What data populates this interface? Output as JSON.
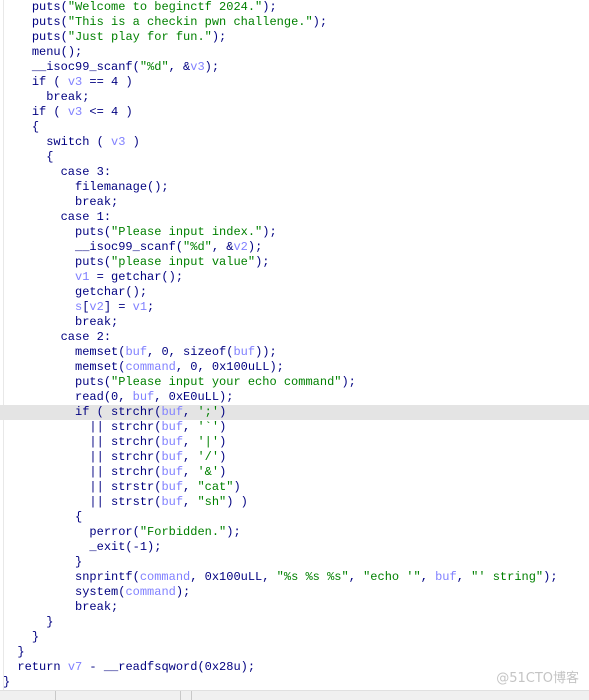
{
  "view": "pseudocode",
  "highlighted_line": 27,
  "colors": {
    "keyword": "#000080",
    "string": "#008000",
    "variable": "#8080ff",
    "highlight": "#e4e4e4"
  },
  "lines": [
    {
      "indent": 4,
      "seg": [
        [
          "k",
          "puts("
        ],
        [
          "s",
          "\"Welcome to beginctf 2024.\""
        ],
        [
          "k",
          ");"
        ]
      ]
    },
    {
      "indent": 4,
      "seg": [
        [
          "k",
          "puts("
        ],
        [
          "s",
          "\"This is a checkin pwn challenge.\""
        ],
        [
          "k",
          ");"
        ]
      ]
    },
    {
      "indent": 4,
      "seg": [
        [
          "k",
          "puts("
        ],
        [
          "s",
          "\"Just play for fun.\""
        ],
        [
          "k",
          ");"
        ]
      ]
    },
    {
      "indent": 4,
      "seg": [
        [
          "k",
          "menu();"
        ]
      ]
    },
    {
      "indent": 4,
      "seg": [
        [
          "k",
          "__isoc99_scanf("
        ],
        [
          "s",
          "\"%d\""
        ],
        [
          "k",
          ", &"
        ],
        [
          "v",
          "v3"
        ],
        [
          "k",
          ");"
        ]
      ]
    },
    {
      "indent": 4,
      "seg": [
        [
          "k",
          "if ( "
        ],
        [
          "v",
          "v3"
        ],
        [
          "k",
          " == 4 )"
        ]
      ]
    },
    {
      "indent": 6,
      "seg": [
        [
          "k",
          "break;"
        ]
      ]
    },
    {
      "indent": 4,
      "seg": [
        [
          "k",
          "if ( "
        ],
        [
          "v",
          "v3"
        ],
        [
          "k",
          " <= 4 )"
        ]
      ]
    },
    {
      "indent": 4,
      "seg": [
        [
          "k",
          "{"
        ]
      ]
    },
    {
      "indent": 6,
      "seg": [
        [
          "k",
          "switch ( "
        ],
        [
          "v",
          "v3"
        ],
        [
          "k",
          " )"
        ]
      ]
    },
    {
      "indent": 6,
      "seg": [
        [
          "k",
          "{"
        ]
      ]
    },
    {
      "indent": 8,
      "seg": [
        [
          "k",
          "case 3:"
        ]
      ]
    },
    {
      "indent": 10,
      "seg": [
        [
          "k",
          "filemanage();"
        ]
      ]
    },
    {
      "indent": 10,
      "seg": [
        [
          "k",
          "break;"
        ]
      ]
    },
    {
      "indent": 8,
      "seg": [
        [
          "k",
          "case 1:"
        ]
      ]
    },
    {
      "indent": 10,
      "seg": [
        [
          "k",
          "puts("
        ],
        [
          "s",
          "\"Please input index.\""
        ],
        [
          "k",
          ");"
        ]
      ]
    },
    {
      "indent": 10,
      "seg": [
        [
          "k",
          "__isoc99_scanf("
        ],
        [
          "s",
          "\"%d\""
        ],
        [
          "k",
          ", &"
        ],
        [
          "v",
          "v2"
        ],
        [
          "k",
          ");"
        ]
      ]
    },
    {
      "indent": 10,
      "seg": [
        [
          "k",
          "puts("
        ],
        [
          "s",
          "\"please input value\""
        ],
        [
          "k",
          ");"
        ]
      ]
    },
    {
      "indent": 10,
      "seg": [
        [
          "v",
          "v1"
        ],
        [
          "k",
          " = getchar();"
        ]
      ]
    },
    {
      "indent": 10,
      "seg": [
        [
          "k",
          "getchar();"
        ]
      ]
    },
    {
      "indent": 10,
      "seg": [
        [
          "v",
          "s"
        ],
        [
          "k",
          "["
        ],
        [
          "v",
          "v2"
        ],
        [
          "k",
          "] = "
        ],
        [
          "v",
          "v1"
        ],
        [
          "k",
          ";"
        ]
      ]
    },
    {
      "indent": 10,
      "seg": [
        [
          "k",
          "break;"
        ]
      ]
    },
    {
      "indent": 8,
      "seg": [
        [
          "k",
          "case 2:"
        ]
      ]
    },
    {
      "indent": 10,
      "seg": [
        [
          "k",
          "memset("
        ],
        [
          "v",
          "buf"
        ],
        [
          "k",
          ", 0, sizeof("
        ],
        [
          "v",
          "buf"
        ],
        [
          "k",
          "));"
        ]
      ]
    },
    {
      "indent": 10,
      "seg": [
        [
          "k",
          "memset("
        ],
        [
          "v",
          "command"
        ],
        [
          "k",
          ", 0, 0x100uLL);"
        ]
      ]
    },
    {
      "indent": 10,
      "seg": [
        [
          "k",
          "puts("
        ],
        [
          "s",
          "\"Please input your echo command\""
        ],
        [
          "k",
          ");"
        ]
      ]
    },
    {
      "indent": 10,
      "seg": [
        [
          "k",
          "read(0, "
        ],
        [
          "v",
          "buf"
        ],
        [
          "k",
          ", 0xE0uLL);"
        ]
      ]
    },
    {
      "indent": 10,
      "seg": [
        [
          "k",
          "if ( strchr("
        ],
        [
          "v",
          "buf"
        ],
        [
          "k",
          ", "
        ],
        [
          "s",
          "';'"
        ],
        [
          "k",
          ")"
        ]
      ]
    },
    {
      "indent": 12,
      "seg": [
        [
          "k",
          "|| strchr("
        ],
        [
          "v",
          "buf"
        ],
        [
          "k",
          ", "
        ],
        [
          "s",
          "'`'"
        ],
        [
          "k",
          ")"
        ]
      ]
    },
    {
      "indent": 12,
      "seg": [
        [
          "k",
          "|| strchr("
        ],
        [
          "v",
          "buf"
        ],
        [
          "k",
          ", "
        ],
        [
          "s",
          "'|'"
        ],
        [
          "k",
          ")"
        ]
      ]
    },
    {
      "indent": 12,
      "seg": [
        [
          "k",
          "|| strchr("
        ],
        [
          "v",
          "buf"
        ],
        [
          "k",
          ", "
        ],
        [
          "s",
          "'/'"
        ],
        [
          "k",
          ")"
        ]
      ]
    },
    {
      "indent": 12,
      "seg": [
        [
          "k",
          "|| strchr("
        ],
        [
          "v",
          "buf"
        ],
        [
          "k",
          ", "
        ],
        [
          "s",
          "'&'"
        ],
        [
          "k",
          ")"
        ]
      ]
    },
    {
      "indent": 12,
      "seg": [
        [
          "k",
          "|| strstr("
        ],
        [
          "v",
          "buf"
        ],
        [
          "k",
          ", "
        ],
        [
          "s",
          "\"cat\""
        ],
        [
          "k",
          ")"
        ]
      ]
    },
    {
      "indent": 12,
      "seg": [
        [
          "k",
          "|| strstr("
        ],
        [
          "v",
          "buf"
        ],
        [
          "k",
          ", "
        ],
        [
          "s",
          "\"sh\""
        ],
        [
          "k",
          ") )"
        ]
      ]
    },
    {
      "indent": 10,
      "seg": [
        [
          "k",
          "{"
        ]
      ]
    },
    {
      "indent": 12,
      "seg": [
        [
          "k",
          "perror("
        ],
        [
          "s",
          "\"Forbidden.\""
        ],
        [
          "k",
          ");"
        ]
      ]
    },
    {
      "indent": 12,
      "seg": [
        [
          "k",
          "_exit(-1);"
        ]
      ]
    },
    {
      "indent": 10,
      "seg": [
        [
          "k",
          "}"
        ]
      ]
    },
    {
      "indent": 10,
      "seg": [
        [
          "k",
          "snprintf("
        ],
        [
          "v",
          "command"
        ],
        [
          "k",
          ", 0x100uLL, "
        ],
        [
          "s",
          "\"%s %s %s\""
        ],
        [
          "k",
          ", "
        ],
        [
          "s",
          "\"echo '\""
        ],
        [
          "k",
          ", "
        ],
        [
          "v",
          "buf"
        ],
        [
          "k",
          ", "
        ],
        [
          "s",
          "\"' string\""
        ],
        [
          "k",
          ");"
        ]
      ]
    },
    {
      "indent": 10,
      "seg": [
        [
          "k",
          "system("
        ],
        [
          "v",
          "command"
        ],
        [
          "k",
          ");"
        ]
      ]
    },
    {
      "indent": 10,
      "seg": [
        [
          "k",
          "break;"
        ]
      ]
    },
    {
      "indent": 6,
      "seg": [
        [
          "k",
          "}"
        ]
      ]
    },
    {
      "indent": 4,
      "seg": [
        [
          "k",
          "}"
        ]
      ]
    },
    {
      "indent": 2,
      "seg": [
        [
          "k",
          "}"
        ]
      ]
    },
    {
      "indent": 2,
      "seg": [
        [
          "k",
          "return "
        ],
        [
          "v",
          "v7"
        ],
        [
          "k",
          " - __readfsqword(0x28u);"
        ]
      ]
    },
    {
      "indent": 0,
      "seg": [
        [
          "k",
          "}"
        ]
      ]
    }
  ],
  "watermark": "@51CTO博客"
}
